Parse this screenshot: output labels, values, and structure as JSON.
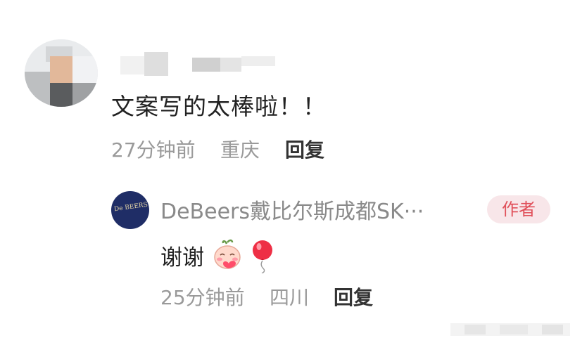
{
  "comment": {
    "text": "文案写的太棒啦！！",
    "time": "27分钟前",
    "location": "重庆",
    "reply_label": "回复"
  },
  "reply": {
    "username": "DeBeers戴比尔斯成都SK···",
    "avatar_text": "De BEERS",
    "author_badge": "作者",
    "text": "谢谢",
    "emojis": [
      "blushing-face-emoji",
      "red-balloon-emoji"
    ],
    "time": "25分钟前",
    "location": "四川",
    "reply_label": "回复"
  },
  "colors": {
    "author_badge_bg": "#f8e6e9",
    "author_badge_text": "#e0505a",
    "meta_text": "#9a9a9a",
    "avatar_reply_bg": "#1f2d66"
  }
}
